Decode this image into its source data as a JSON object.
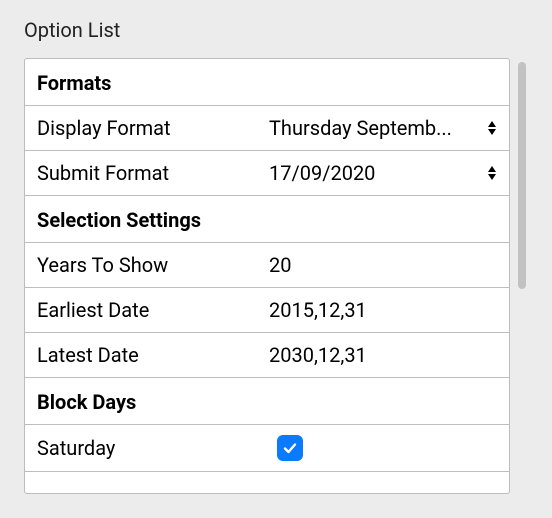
{
  "panel": {
    "title": "Option List"
  },
  "sections": {
    "formats": {
      "heading": "Formats",
      "display_format": {
        "label": "Display Format",
        "value": "Thursday Septemb..."
      },
      "submit_format": {
        "label": "Submit Format",
        "value": "17/09/2020"
      }
    },
    "selection_settings": {
      "heading": "Selection Settings",
      "years_to_show": {
        "label": "Years To Show",
        "value": "20"
      },
      "earliest_date": {
        "label": "Earliest Date",
        "value": "2015,12,31"
      },
      "latest_date": {
        "label": "Latest Date",
        "value": "2030,12,31"
      }
    },
    "block_days": {
      "heading": "Block Days",
      "saturday": {
        "label": "Saturday",
        "checked": true
      }
    }
  }
}
